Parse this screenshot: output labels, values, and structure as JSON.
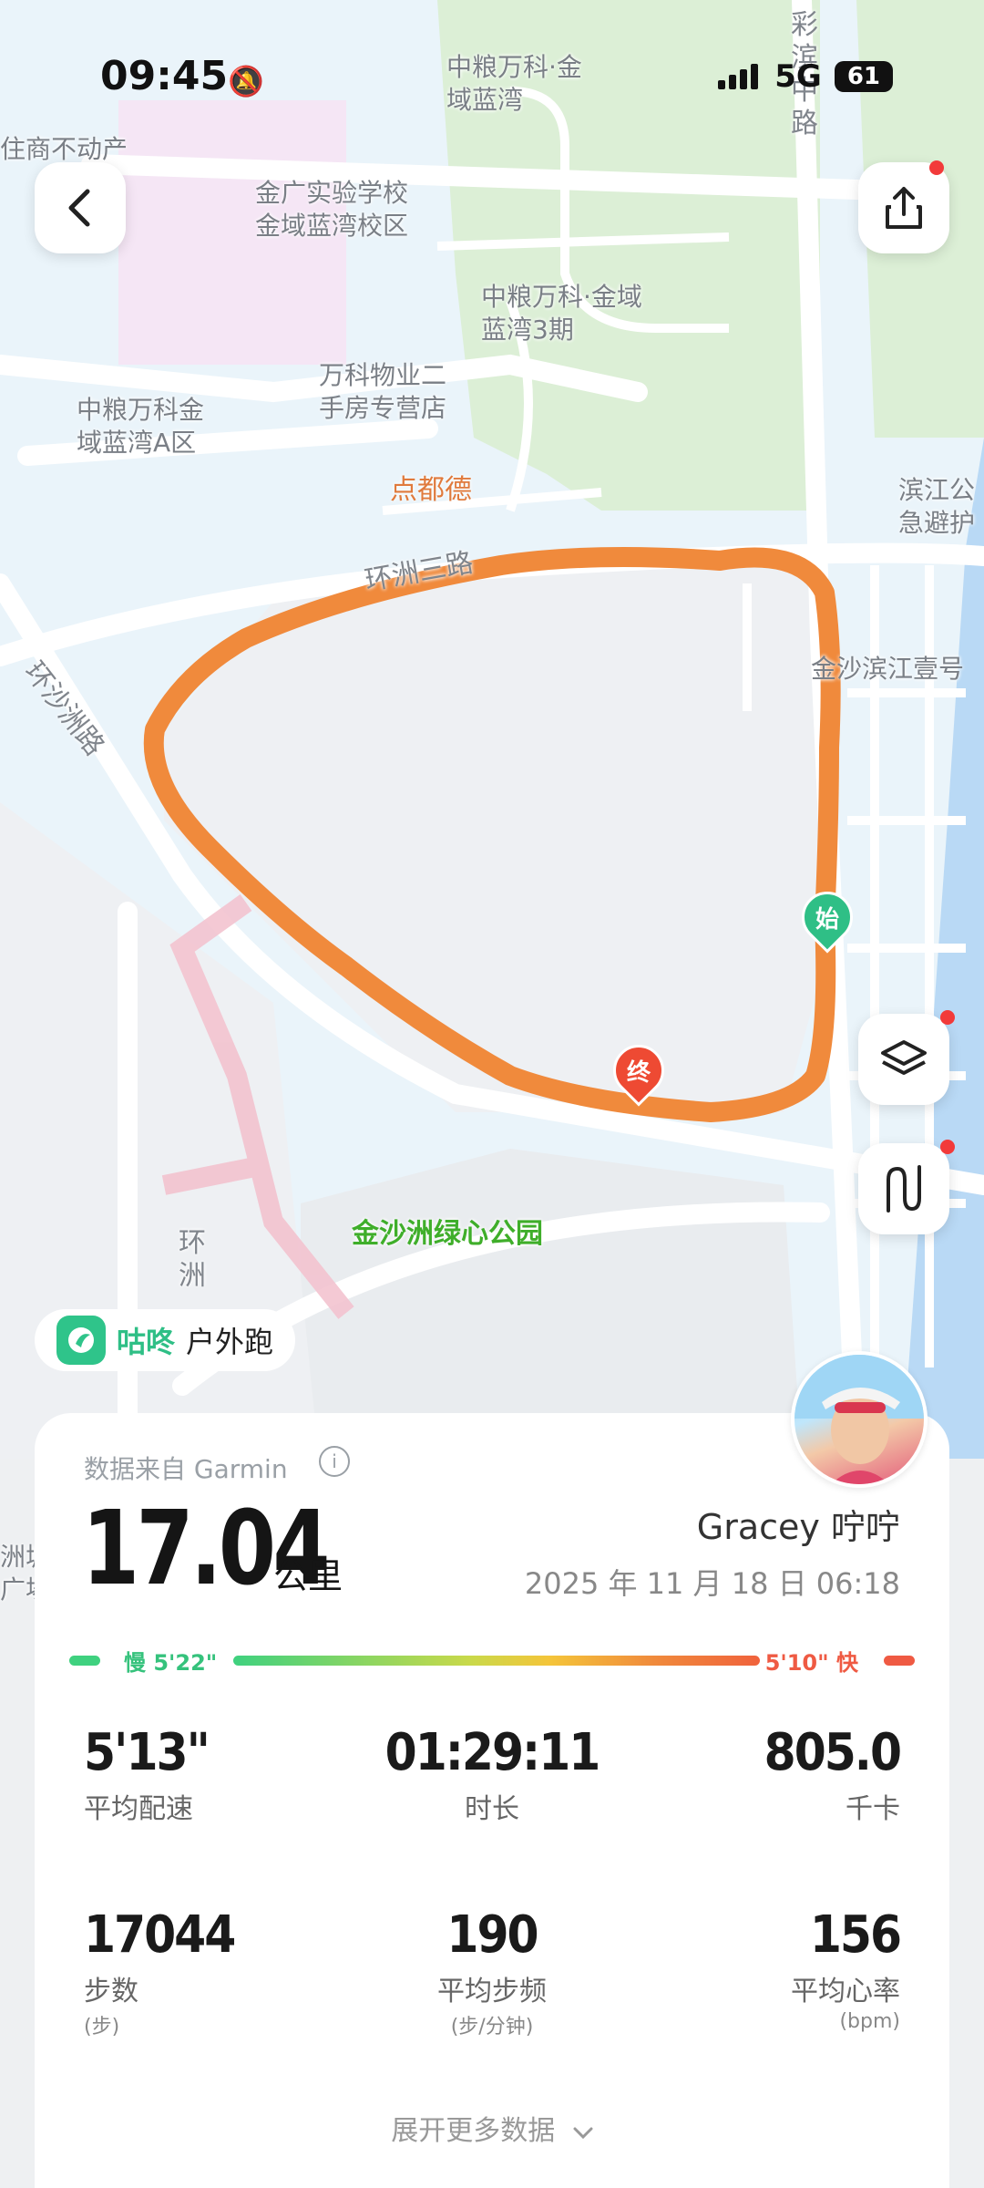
{
  "status_bar": {
    "time": "09:45",
    "network": "5G",
    "battery": "61"
  },
  "map": {
    "labels": [
      {
        "text": "中粮万科·金\n域蓝湾",
        "style": ""
      },
      {
        "text": "住商不动产",
        "style": ""
      },
      {
        "text": "金广实验学校\n金域蓝湾校区",
        "style": ""
      },
      {
        "text": "中粮万科·金域\n蓝湾3期",
        "style": ""
      },
      {
        "text": "万科物业二\n手房专营店",
        "style": ""
      },
      {
        "text": "中粮万科金\n域蓝湾A区",
        "style": ""
      },
      {
        "text": "点都德",
        "style": "poi-orange"
      },
      {
        "text": "滨江公\n急避护",
        "style": ""
      },
      {
        "text": "金沙滨江壹号",
        "style": ""
      },
      {
        "text": "环洲三路",
        "style": "road"
      },
      {
        "text": "彩\n滨\n中\n路",
        "style": "road"
      },
      {
        "text": "环沙洲路",
        "style": "road"
      },
      {
        "text": "金沙洲绿心公园",
        "style": "poi-green"
      },
      {
        "text": "环\n洲",
        "style": "road"
      },
      {
        "text": "洲城\n广場",
        "style": ""
      }
    ],
    "start_marker": "始",
    "end_marker": "终",
    "route_color": "#f08a3c"
  },
  "buttons": {
    "back_icon": "chevron-left-icon",
    "share_icon": "share-icon",
    "layers_icon": "layers-icon",
    "route_icon": "route-icon"
  },
  "brand": {
    "name": "咕咚",
    "activity": "户外跑"
  },
  "summary": {
    "source": "数据来自 Garmin",
    "distance": "17.04",
    "distance_unit": "公里",
    "username": "Gracey 咛咛",
    "datetime": "2025 年 11 月 18 日  06:18"
  },
  "pace_scale": {
    "slow_label": "慢 5'22\"",
    "fast_label": "5'10\" 快"
  },
  "stats": [
    {
      "value": "5'13\"",
      "label": "平均配速",
      "sub": ""
    },
    {
      "value": "01:29:11",
      "label": "时长",
      "sub": ""
    },
    {
      "value": "805.0",
      "label": "千卡",
      "sub": ""
    },
    {
      "value": "17044",
      "label": "步数",
      "sub": "(步)"
    },
    {
      "value": "190",
      "label": "平均步频",
      "sub": "(步/分钟)"
    },
    {
      "value": "156",
      "label": "平均心率",
      "sub": "(bpm)"
    }
  ],
  "expand_label": "展开更多数据"
}
